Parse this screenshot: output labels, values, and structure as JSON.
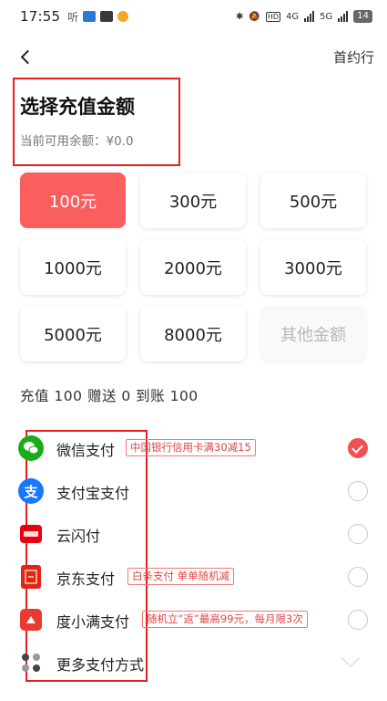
{
  "status": {
    "time": "17:55",
    "left_text": "听",
    "network_4g": "4G",
    "network_5g": "5G",
    "hd": "HD",
    "battery": "14"
  },
  "nav": {
    "back_icon": "chevron-left-icon",
    "right_label": "首约行"
  },
  "header": {
    "title": "选择充值金额",
    "balance": "当前可用余额：¥0.0"
  },
  "amounts": [
    {
      "label": "100元",
      "selected": true
    },
    {
      "label": "300元"
    },
    {
      "label": "500元"
    },
    {
      "label": "1000元"
    },
    {
      "label": "2000元"
    },
    {
      "label": "3000元"
    },
    {
      "label": "5000元"
    },
    {
      "label": "8000元"
    },
    {
      "label": "其他金额",
      "placeholder": true
    }
  ],
  "summary": "充值 100 赠送 0 到账 100",
  "payments": [
    {
      "label": "微信支付",
      "icon": "wechat-pay-icon",
      "promo": "中国银行信用卡满30减15",
      "checked": true
    },
    {
      "label": "支付宝支付",
      "icon": "alipay-icon",
      "promo": "",
      "checked": false
    },
    {
      "label": "云闪付",
      "icon": "unionpay-quickpass-icon",
      "promo": "",
      "checked": false
    },
    {
      "label": "京东支付",
      "icon": "jd-pay-icon",
      "promo": "白条支付 单单随机减",
      "checked": false
    },
    {
      "label": "度小满支付",
      "icon": "duxiaoman-pay-icon",
      "promo": "随机立“返”最高99元，每月限3次",
      "checked": false
    }
  ],
  "more_payments": {
    "label": "更多支付方式",
    "icon": "more-dots-icon"
  },
  "colors": {
    "accent": "#fa5e5e",
    "highlight_border": "#e8201f",
    "wechat": "#1aad19",
    "alipay": "#1677ff",
    "unionpay": "#e60012",
    "jd": "#e1251b",
    "duxiaoman": "#e93a2f"
  }
}
